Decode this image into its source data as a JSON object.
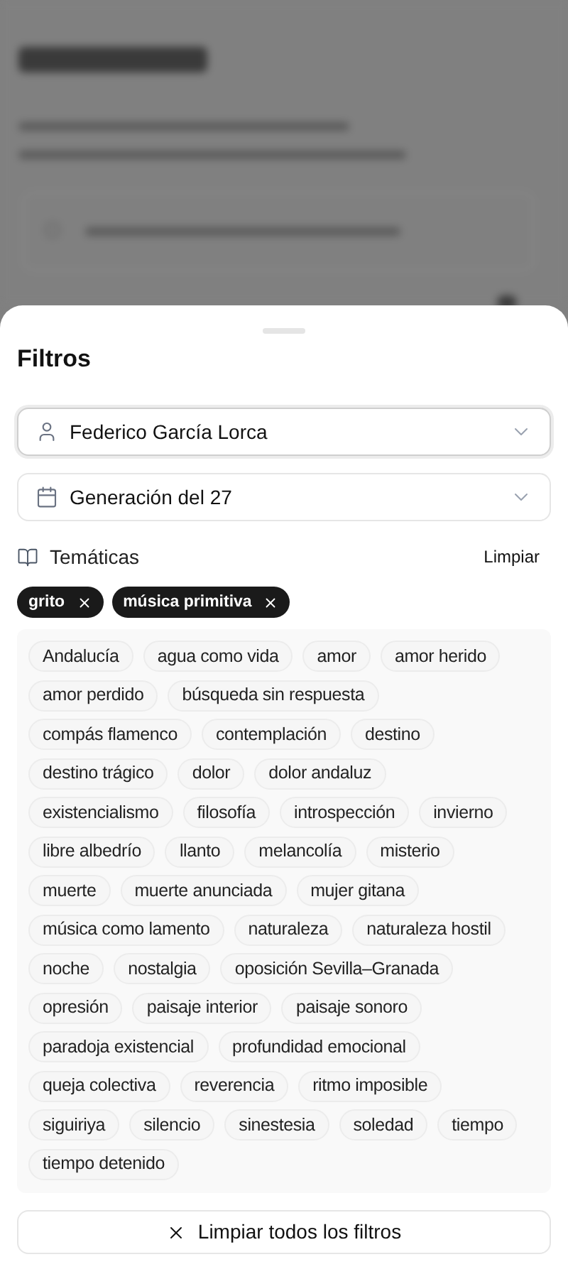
{
  "sheet": {
    "title": "Filtros",
    "selects": [
      {
        "kind": "person",
        "value": "Federico García Lorca",
        "focused": true
      },
      {
        "kind": "calendar",
        "value": "Generación del 27",
        "focused": false
      }
    ],
    "themes": {
      "label": "Temáticas",
      "clear": "Limpiar",
      "active": [
        "grito",
        "música primitiva"
      ],
      "options": [
        {
          "label": "Andalucía",
          "selected": false
        },
        {
          "label": "agua como vida",
          "selected": false
        },
        {
          "label": "amor",
          "selected": false
        },
        {
          "label": "amor herido",
          "selected": false
        },
        {
          "label": "amor perdido",
          "selected": false
        },
        {
          "label": "búsqueda sin respuesta",
          "selected": false
        },
        {
          "label": "compás flamenco",
          "selected": false
        },
        {
          "label": "contemplación",
          "selected": false
        },
        {
          "label": "destino",
          "selected": false
        },
        {
          "label": "destino trágico",
          "selected": false
        },
        {
          "label": "dolor",
          "selected": false
        },
        {
          "label": "dolor andaluz",
          "selected": false
        },
        {
          "label": "existencialismo",
          "selected": false
        },
        {
          "label": "filosofía",
          "selected": false
        },
        {
          "label": "introspección",
          "selected": false
        },
        {
          "label": "invierno",
          "selected": false
        },
        {
          "label": "libre albedrío",
          "selected": false
        },
        {
          "label": "llanto",
          "selected": false
        },
        {
          "label": "melancolía",
          "selected": false
        },
        {
          "label": "misterio",
          "selected": false
        },
        {
          "label": "muerte",
          "selected": false
        },
        {
          "label": "muerte anunciada",
          "selected": false
        },
        {
          "label": "mujer gitana",
          "selected": false
        },
        {
          "label": "música como lamento",
          "selected": false
        },
        {
          "label": "naturaleza",
          "selected": false
        },
        {
          "label": "naturaleza hostil",
          "selected": false
        },
        {
          "label": "noche",
          "selected": false
        },
        {
          "label": "nostalgia",
          "selected": false
        },
        {
          "label": "oposición Sevilla–Granada",
          "selected": false
        },
        {
          "label": "opresión",
          "selected": false
        },
        {
          "label": "paisaje interior",
          "selected": false
        },
        {
          "label": "paisaje sonoro",
          "selected": false
        },
        {
          "label": "paradoja existencial",
          "selected": false
        },
        {
          "label": "profundidad emocional",
          "selected": false
        },
        {
          "label": "queja colectiva",
          "selected": false
        },
        {
          "label": "reverencia",
          "selected": false
        },
        {
          "label": "ritmo imposible",
          "selected": false
        },
        {
          "label": "siguiriya",
          "selected": false
        },
        {
          "label": "silencio",
          "selected": false
        },
        {
          "label": "sinestesia",
          "selected": false
        },
        {
          "label": "soledad",
          "selected": false
        },
        {
          "label": "tiempo",
          "selected": false
        },
        {
          "label": "tiempo detenido",
          "selected": false
        }
      ]
    },
    "clear_all": "Limpiar todos los filtros"
  }
}
